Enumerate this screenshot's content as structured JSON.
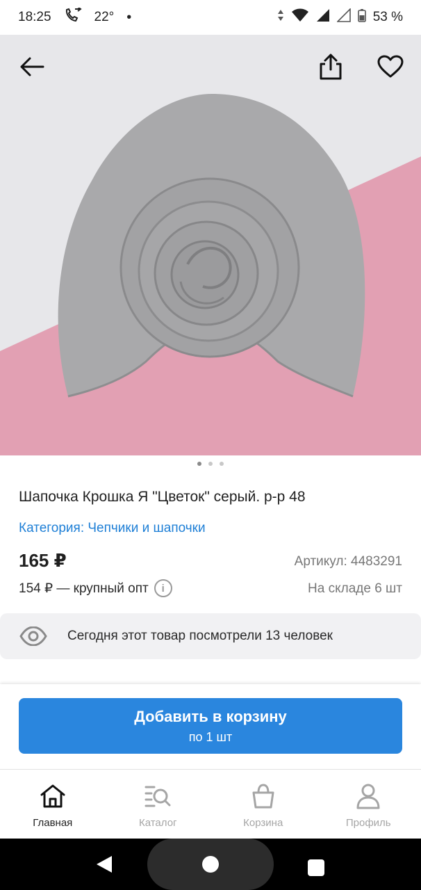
{
  "status": {
    "time": "18:25",
    "temperature": "22°",
    "battery": "53 %",
    "icons": [
      "call-forwarding-icon",
      "data-arrows-icon",
      "wifi-icon",
      "signal-icon",
      "signal-icon",
      "battery-icon"
    ]
  },
  "hero": {
    "back_icon": "arrow-left-icon",
    "share_icon": "share-icon",
    "fav_icon": "heart-icon",
    "pager_count": 3,
    "pager_active": 0
  },
  "product": {
    "title": "Шапочка Крошка Я \"Цветок\" серый. р-р 48",
    "category": "Категория: Чепчики и шапочки",
    "price": "165 ₽",
    "article": "Артикул: 4483291",
    "bulk_price": "154 ₽ — крупный опт",
    "stock": "На складе 6 шт"
  },
  "views": {
    "text": "Сегодня этот товар посмотрели 13 человек"
  },
  "cart_button": {
    "label": "Добавить в корзину",
    "sub": "по 1 шт"
  },
  "tabs": [
    {
      "label": "Главная",
      "icon": "home-icon",
      "active": true
    },
    {
      "label": "Каталог",
      "icon": "catalog-search-icon",
      "active": false
    },
    {
      "label": "Корзина",
      "icon": "shopping-bag-icon",
      "active": false
    },
    {
      "label": "Профиль",
      "icon": "profile-icon",
      "active": false
    }
  ],
  "colors": {
    "accent": "#2a86de",
    "link": "#1e7fd6",
    "pink_background": "#e2a0b3"
  }
}
